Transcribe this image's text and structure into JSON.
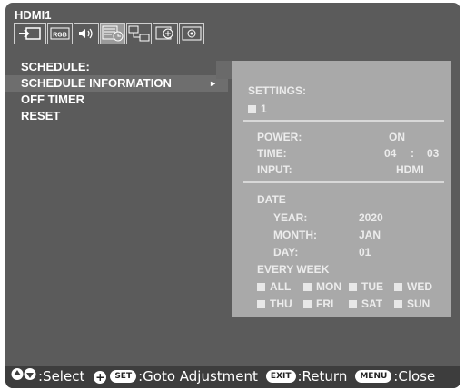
{
  "window": {
    "title": "HDMI1"
  },
  "tabs": [
    {
      "name": "input-icon"
    },
    {
      "name": "rgb-icon",
      "label": "RGB"
    },
    {
      "name": "audio-icon"
    },
    {
      "name": "schedule-icon"
    },
    {
      "name": "multi-display-icon"
    },
    {
      "name": "protect-icon"
    },
    {
      "name": "advanced-settings-icon"
    }
  ],
  "menu": {
    "heading": "SCHEDULE:",
    "items": [
      {
        "label": "SCHEDULE INFORMATION",
        "arrow": "►"
      },
      {
        "label": "OFF TIMER"
      },
      {
        "label": "RESET"
      }
    ]
  },
  "panel": {
    "settings_label": "SETTINGS:",
    "schedule_number": "1",
    "power_label": "POWER:",
    "power_value": "ON",
    "time_label": "TIME:",
    "time_hour": "04",
    "time_sep": ":",
    "time_minute": "03",
    "input_label": "INPUT:",
    "input_value": "HDMI",
    "date_label": "DATE",
    "year_label": "YEAR:",
    "year_value": "2020",
    "month_label": "MONTH:",
    "month_value": "JAN",
    "day_label": "DAY:",
    "day_value": "01",
    "every_week_label": "EVERY WEEK",
    "days_row1": [
      "ALL",
      "MON",
      "TUE",
      "WED"
    ],
    "days_row2": [
      "THU",
      "FRI",
      "SAT",
      "SUN"
    ]
  },
  "footer": {
    "select_text": ":Select",
    "set_key": "SET",
    "goto_text": ":Goto Adjustment",
    "exit_key": "EXIT",
    "return_text": ":Return",
    "menu_key": "MENU",
    "close_text": ":Close"
  },
  "colors": {
    "osd_bg": "#5b5b5b",
    "panel_bg": "#a9a9a9",
    "footer_bg": "#3d3d3d"
  }
}
